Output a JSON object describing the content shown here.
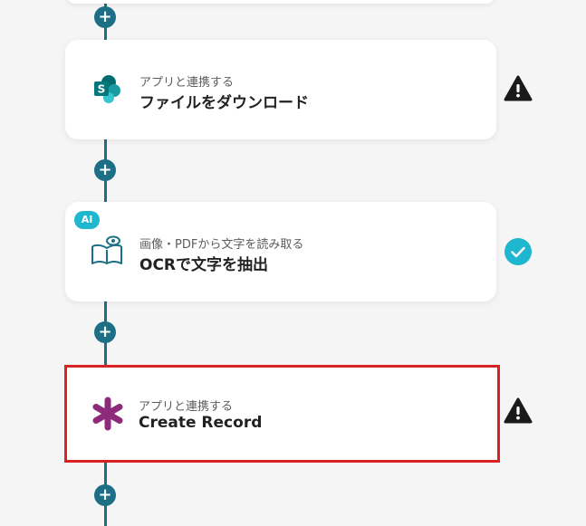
{
  "steps": [
    {
      "subtitle": "アプリと連携する",
      "title": "ファイルをダウンロード",
      "icon": "sharepoint-icon",
      "status": "warning"
    },
    {
      "badge": "AI",
      "subtitle": "画像・PDFから文字を読み取る",
      "title": "OCRで文字を抽出",
      "icon": "ocr-book-eye-icon",
      "status": "success"
    },
    {
      "subtitle": "アプリと連携する",
      "title": "Create Record",
      "icon": "asterisk-icon",
      "status": "warning",
      "selected": true
    }
  ],
  "add_button_label": "+",
  "colors": {
    "connector": "#1d6f86",
    "warning": "#1a1a1a",
    "success": "#1fb7cf",
    "selection_border": "#d92222",
    "asterisk": "#8e2a7a",
    "sharepoint": "#0f7c6b"
  }
}
